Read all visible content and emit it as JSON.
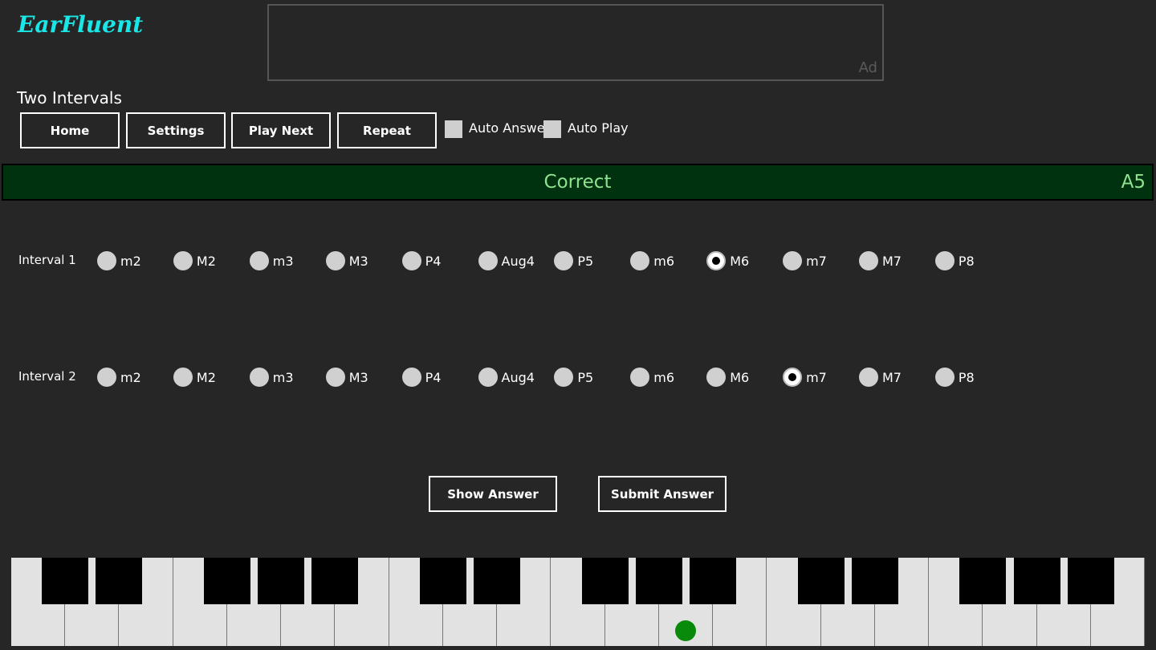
{
  "app": {
    "logo": "EarFluent"
  },
  "ad": {
    "label": "Ad"
  },
  "mode_title": "Two Intervals",
  "toolbar": {
    "buttons": [
      "Home",
      "Settings",
      "Play Next",
      "Repeat"
    ],
    "auto_answer": {
      "label": "Auto Answer",
      "checked": false
    },
    "auto_play": {
      "label": "Auto Play",
      "checked": false
    }
  },
  "status": {
    "text": "Correct",
    "note": "A5",
    "color": "#8fe38f",
    "background": "#003210"
  },
  "intervals": {
    "options": [
      "m2",
      "M2",
      "m3",
      "M3",
      "P4",
      "Aug4",
      "P5",
      "m6",
      "M6",
      "m7",
      "M7",
      "P8"
    ],
    "rows": [
      {
        "label": "Interval 1",
        "selected": "M6"
      },
      {
        "label": "Interval 2",
        "selected": "m7"
      }
    ]
  },
  "actions": {
    "show_answer": "Show Answer",
    "submit_answer": "Submit Answer"
  },
  "piano": {
    "white_keys": 21,
    "highlighted_white_key": 12,
    "marker_color": "#0a8a0a"
  }
}
